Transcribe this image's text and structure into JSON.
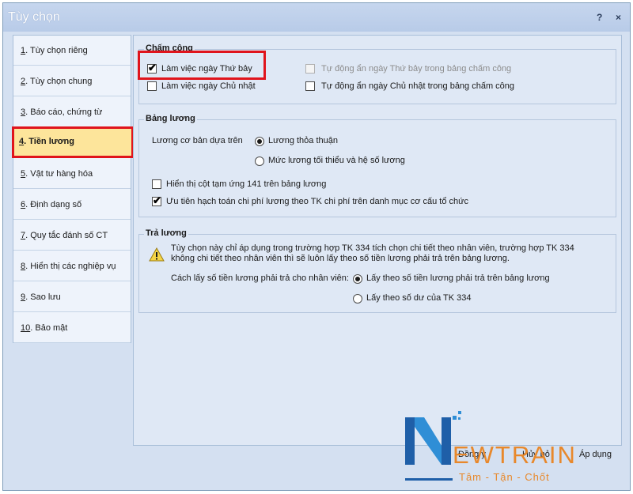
{
  "window": {
    "title": "Tùy chọn",
    "help": "?",
    "close": "×"
  },
  "nav": {
    "items": [
      {
        "num": "1",
        "text": ". Tùy chọn riêng"
      },
      {
        "num": "2",
        "text": ". Tùy chọn chung"
      },
      {
        "num": "3",
        "text": ". Báo cáo, chứng từ"
      },
      {
        "num": "4",
        "text": ". Tiền lương"
      },
      {
        "num": "5",
        "text": ". Vật tư hàng hóa"
      },
      {
        "num": "6",
        "text": ". Định dạng số"
      },
      {
        "num": "7",
        "text": ". Quy tắc đánh số CT"
      },
      {
        "num": "8",
        "text": ". Hiển thị các nghiệp vụ"
      },
      {
        "num": "9",
        "text": ". Sao lưu"
      },
      {
        "num": "10",
        "text": ". Bảo mật"
      }
    ],
    "active_index": 3
  },
  "cham_cong": {
    "title": "Chấm công",
    "lam_viec_thu_bay": "Làm việc ngày Thứ bảy",
    "lam_viec_chu_nhat": "Làm việc ngày Chủ nhật",
    "tu_dong_an_thu_bay": "Tự động ẩn ngày Thứ bảy trong bảng chấm công",
    "tu_dong_an_chu_nhat": "Tự động ẩn ngày Chủ nhật trong bảng chấm công"
  },
  "bang_luong": {
    "title": "Bảng lương",
    "co_ban_label": "Lương cơ bản dựa trên",
    "opt_thoa_thuan": "Lương thỏa thuận",
    "opt_toi_thieu": "Mức lương tối thiểu và hệ số lương",
    "hien_thi_tam_ung": "Hiển thị cột tạm ứng 141 trên bảng lương",
    "uu_tien": "Ưu tiên hạch toán chi phí lương theo TK chi phí trên danh mục cơ cấu tổ chức"
  },
  "tra_luong": {
    "title": "Trả lương",
    "note_line1": "Tùy chọn này chỉ áp dụng trong trường hợp TK 334 tích chọn chi tiết theo nhân viên, trường hợp TK 334",
    "note_line2": "không chi tiết theo nhân viên thì sẽ luôn lấy theo số tiền lương phải trả trên bảng lương.",
    "cach_lay_label": "Cách lấy số tiền lương phải trả cho nhân viên:",
    "opt_bang_luong": "Lấy theo số tiền lương phải trả trên bảng lương",
    "opt_so_du": "Lấy theo số dư của TK 334"
  },
  "footer": {
    "dong_y": "Đồng ý",
    "huy_bo": "Hủy bỏ",
    "ap_dung": "Áp dụng"
  },
  "logo": {
    "brand": "EWTRAIN",
    "tagline": "Tâm - Tận - Chốt"
  },
  "colors": {
    "accent_red": "#e0141c",
    "active_nav": "#fde59b",
    "logo_blue": "#1f5fa8",
    "logo_orange": "#e8882b"
  }
}
